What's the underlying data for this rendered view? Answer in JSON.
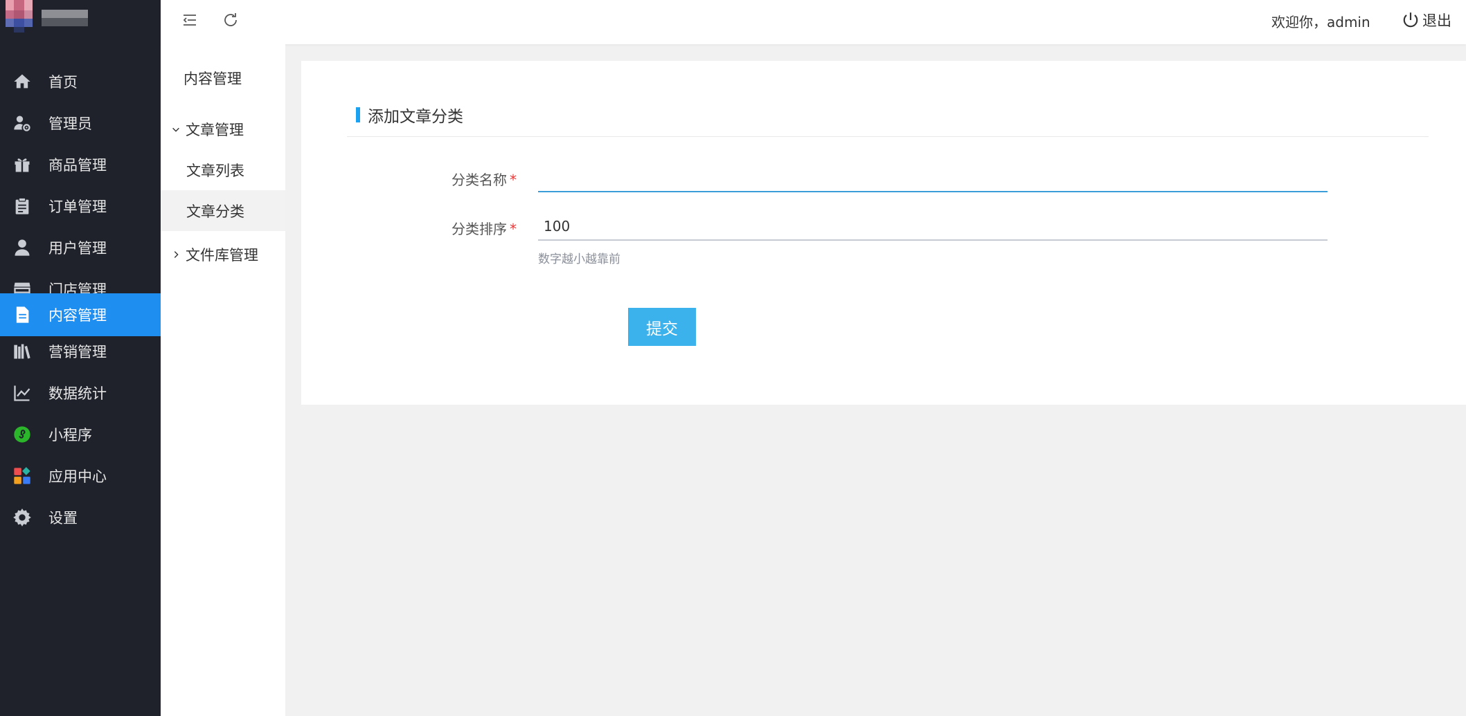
{
  "colors": {
    "sidebar_bg": "#1f222b",
    "sidebar_active": "#1e8ff0",
    "accent": "#1aa1f0",
    "submit_bg": "#3cb2ec",
    "required": "#e33333"
  },
  "sidebar": {
    "items": [
      {
        "label": "首页",
        "icon": "home-icon"
      },
      {
        "label": "管理员",
        "icon": "admin-user-gear-icon"
      },
      {
        "label": "商品管理",
        "icon": "gift-icon"
      },
      {
        "label": "订单管理",
        "icon": "clipboard-icon"
      },
      {
        "label": "用户管理",
        "icon": "user-icon"
      },
      {
        "label": "门店管理",
        "icon": "store-icon"
      },
      {
        "label": "内容管理",
        "icon": "document-icon",
        "active": true
      },
      {
        "label": "营销管理",
        "icon": "books-icon"
      },
      {
        "label": "数据统计",
        "icon": "line-chart-icon"
      },
      {
        "label": "小程序",
        "icon": "mini-program-icon"
      },
      {
        "label": "应用中心",
        "icon": "apps-icon"
      },
      {
        "label": "设置",
        "icon": "gear-icon"
      }
    ]
  },
  "header": {
    "welcome": "欢迎你，admin",
    "logout_label": "退出"
  },
  "submenu": {
    "title": "内容管理",
    "groups": [
      {
        "label": "文章管理",
        "expanded": true,
        "items": [
          {
            "label": "文章列表"
          },
          {
            "label": "文章分类",
            "active": true
          }
        ]
      },
      {
        "label": "文件库管理",
        "expanded": false
      }
    ]
  },
  "form": {
    "title": "添加文章分类",
    "fields": [
      {
        "label": "分类名称",
        "required_mark": "*",
        "value": ""
      },
      {
        "label": "分类排序",
        "required_mark": "*",
        "value": "100",
        "hint": "数字越小越靠前"
      }
    ],
    "submit_label": "提交"
  }
}
